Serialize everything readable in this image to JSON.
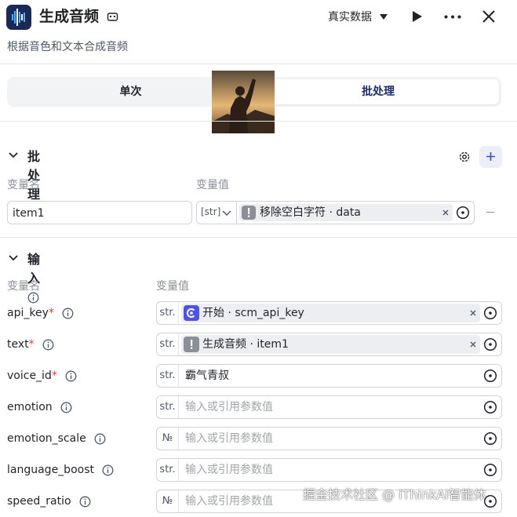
{
  "header": {
    "title": "生成音频",
    "subtitle": "根据音色和文本合成音频",
    "data_mode": "真实数据",
    "icons": [
      "app-audio-icon",
      "text-edit-icon",
      "play-icon",
      "more-icon",
      "close-icon"
    ]
  },
  "tabs": [
    {
      "label": "单次",
      "active": false
    },
    {
      "label": "批处理",
      "active": true
    }
  ],
  "batch": {
    "title": "批处理",
    "col_name": "变量名",
    "col_value": "变量值",
    "item": {
      "name": "item1",
      "type": "[str]",
      "ref_label": "移除空白字符 · data"
    }
  },
  "input": {
    "title": "输入",
    "col_name": "变量名",
    "col_value": "变量值",
    "rows": [
      {
        "label": "api_key",
        "required": "*",
        "type": "str.",
        "value": "开始 · scm_api_key",
        "kind": "ref-start"
      },
      {
        "label": "text",
        "required": "*",
        "type": "str.",
        "value": "生成音频 · item1",
        "kind": "ref-node"
      },
      {
        "label": "voice_id",
        "required": "*",
        "type": "str.",
        "value": "霸气青叔",
        "kind": "text"
      },
      {
        "label": "emotion",
        "required": "",
        "type": "str.",
        "placeholder": "输入或引用参数值",
        "kind": "empty"
      },
      {
        "label": "emotion_scale",
        "required": "",
        "type": "№",
        "placeholder": "输入或引用参数值",
        "kind": "empty"
      },
      {
        "label": "language_boost",
        "required": "",
        "type": "str.",
        "placeholder": "输入或引用参数值",
        "kind": "empty"
      },
      {
        "label": "speed_ratio",
        "required": "",
        "type": "№",
        "placeholder": "输入或引用参数值",
        "kind": "empty"
      }
    ]
  },
  "watermark": "掘金技术社区 @ iThinkAi智能体",
  "colors": {
    "accent": "#1e2b6b",
    "start_icon": "#4d53e8",
    "node_icon": "#8a8f99",
    "required": "#e53935"
  }
}
